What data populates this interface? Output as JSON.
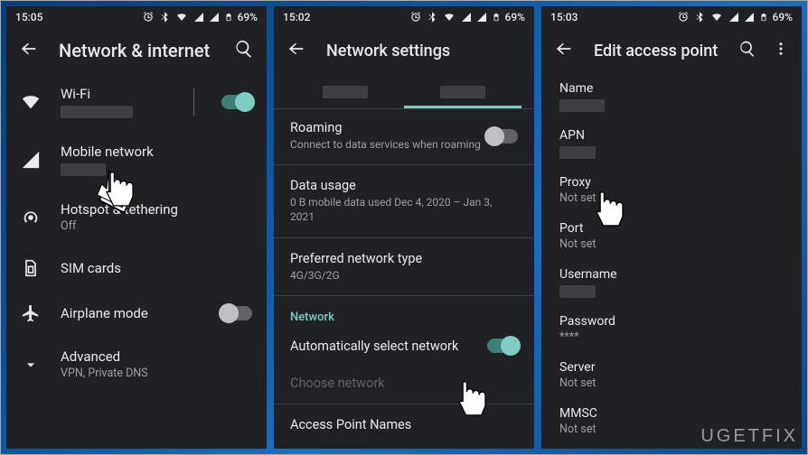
{
  "statusbar": {
    "battery": "69%"
  },
  "screens": [
    {
      "time": "15:05",
      "title": "Network & internet",
      "items": {
        "wifi": {
          "label": "Wi-Fi",
          "on": true
        },
        "mobile": {
          "label": "Mobile network"
        },
        "hotspot": {
          "label": "Hotspot & tethering",
          "sub": "Off"
        },
        "sim": {
          "label": "SIM cards"
        },
        "airplane": {
          "label": "Airplane mode",
          "on": false
        },
        "advanced": {
          "label": "Advanced",
          "sub": "VPN, Private DNS"
        }
      }
    },
    {
      "time": "15:02",
      "title": "Network settings",
      "roaming": {
        "label": "Roaming",
        "sub": "Connect to data services when roaming",
        "on": false
      },
      "data_usage": {
        "label": "Data usage",
        "sub": "0 B mobile data used Dec 4, 2020 – Jan 3, 2021"
      },
      "pref_net": {
        "label": "Preferred network type",
        "sub": "4G/3G/2G"
      },
      "section_network": "Network",
      "auto_select": {
        "label": "Automatically select network",
        "on": true
      },
      "choose_network": {
        "label": "Choose network"
      },
      "apn": {
        "label": "Access Point Names"
      }
    },
    {
      "time": "15:03",
      "title": "Edit access point",
      "fields": {
        "name": {
          "label": "Name"
        },
        "apn": {
          "label": "APN"
        },
        "proxy": {
          "label": "Proxy",
          "value": "Not set"
        },
        "port": {
          "label": "Port",
          "value": "Not set"
        },
        "username": {
          "label": "Username"
        },
        "password": {
          "label": "Password",
          "value": "****"
        },
        "server": {
          "label": "Server",
          "value": "Not set"
        },
        "mmsc": {
          "label": "MMSC",
          "value": "Not set"
        }
      }
    }
  ],
  "watermark": "UGETFIX"
}
